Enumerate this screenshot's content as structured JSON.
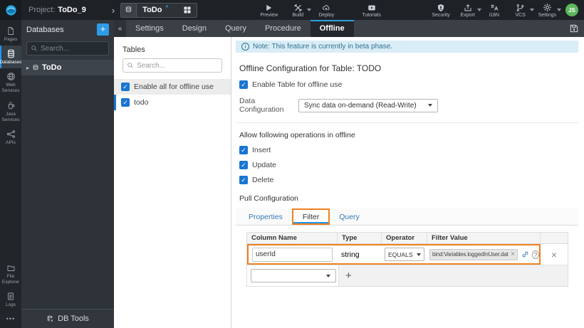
{
  "colors": {
    "accent": "#2196f3",
    "annotation": "#ee8021",
    "note_bg": "#d9edf7",
    "note_text": "#31708f",
    "avatar_bg": "#5cb85c",
    "checkbox": "#1976d2"
  },
  "glyphs": {
    "close": "×",
    "check": "✓",
    "question": "?",
    "info": "i",
    "expand": "▸",
    "chevron": "›",
    "collapse": "«",
    "plus": "+",
    "more": "•••"
  },
  "topbar": {
    "project_label": "Project:",
    "project_name": "ToDo_9",
    "active_resource": {
      "name": "ToDo",
      "modified_marker": "*"
    },
    "actions_left": [
      {
        "label": "Preview"
      },
      {
        "label": "Build"
      },
      {
        "label": "Deploy"
      },
      {
        "label": "Tutorials"
      }
    ],
    "actions_right": [
      {
        "label": "Security"
      },
      {
        "label": "Export"
      },
      {
        "label": "i18N"
      },
      {
        "label": "VCS"
      },
      {
        "label": "Settings"
      }
    ],
    "avatar": "JS"
  },
  "sidebar": {
    "items": [
      {
        "label": "Pages"
      },
      {
        "label": "Databases",
        "active": true
      },
      {
        "label": "Web Services"
      },
      {
        "label": "Java Services"
      },
      {
        "label": "APIs"
      }
    ],
    "bottom_items": [
      {
        "label": "File Explorer"
      },
      {
        "label": "Logs"
      }
    ]
  },
  "db_panel": {
    "title": "Databases",
    "add_button": "+",
    "search_placeholder": "Search...",
    "items": [
      {
        "name": "ToDo",
        "selected": true
      }
    ],
    "footer": "DB Tools"
  },
  "tabbar": {
    "tabs": [
      {
        "label": "Settings"
      },
      {
        "label": "Design"
      },
      {
        "label": "Query"
      },
      {
        "label": "Procedure"
      },
      {
        "label": "Offline",
        "active": true
      }
    ]
  },
  "tables_panel": {
    "title": "Tables",
    "search_placeholder": "Search...",
    "enable_all": {
      "label": "Enable all for offline use",
      "checked": true
    },
    "tables": [
      {
        "name": "todo",
        "checked": true,
        "selected": true
      }
    ]
  },
  "main": {
    "note": "Note: This feature is currently in beta phase.",
    "title": "Offline Configuration for Table: TODO",
    "enable_table": {
      "label": "Enable Table for offline use",
      "checked": true
    },
    "data_configuration": {
      "label": "Data Configuration",
      "value": "Sync data on-demand (Read-Write)"
    },
    "operations": {
      "title": "Allow following operations in offline",
      "items": [
        {
          "label": "Insert",
          "checked": true
        },
        {
          "label": "Update",
          "checked": true
        },
        {
          "label": "Delete",
          "checked": true
        }
      ]
    },
    "pull": {
      "title": "Pull Configuration",
      "tabs": [
        {
          "label": "Properties"
        },
        {
          "label": "Filter",
          "active": true,
          "annotated": true
        },
        {
          "label": "Query"
        }
      ]
    },
    "filter_table": {
      "headers": [
        "Column Name",
        "Type",
        "Operator",
        "Filter Value",
        ""
      ],
      "rows": [
        {
          "column_name": "userId",
          "type": "string",
          "operator": "EQUALS",
          "filter_value": "bind:Variables.loggedInUser.data"
        }
      ]
    }
  }
}
